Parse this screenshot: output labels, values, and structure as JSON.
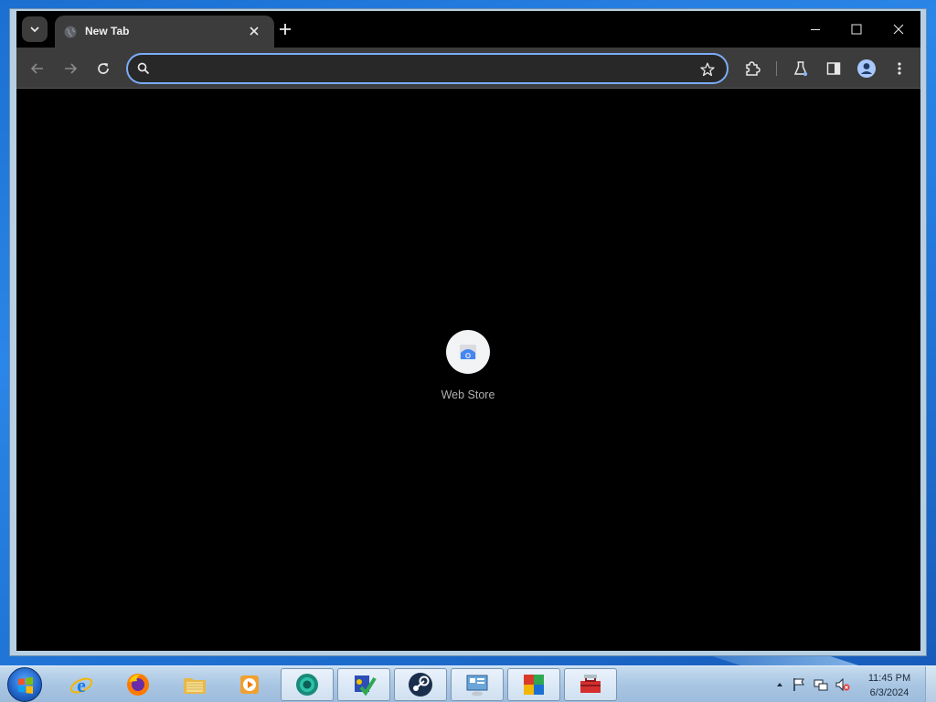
{
  "browser": {
    "tab": {
      "title": "New Tab",
      "favicon": "globe-icon",
      "close_icon": "close-icon"
    },
    "new_tab_icon": "plus-icon",
    "window_controls": [
      "minimize-icon",
      "maximize-icon",
      "close-icon"
    ],
    "toolbar": {
      "back_icon": "arrow-left-icon",
      "forward_icon": "arrow-right-icon",
      "reload_icon": "reload-icon",
      "omnibox": {
        "value": "",
        "placeholder": "",
        "search_icon": "search-icon",
        "bookmark_icon": "star-icon"
      },
      "extensions_icon": "puzzle-icon",
      "labs_icon": "flask-icon",
      "side_panel_icon": "side-panel-icon",
      "profile_icon": "profile-icon",
      "menu_icon": "kebab-menu-icon"
    },
    "ntp": {
      "shortcuts": [
        {
          "label": "Web Store",
          "icon": "web-store-icon"
        }
      ]
    },
    "colors": {
      "frame": "#000000",
      "toolbar": "#3c3c3c",
      "omnibox_focus": "#7cacf8",
      "accent": "#8ab4f8"
    }
  },
  "taskbar": {
    "pinned": [
      {
        "name": "internet-explorer-icon",
        "active": false
      },
      {
        "name": "firefox-icon",
        "active": false
      },
      {
        "name": "file-explorer-icon",
        "active": false
      },
      {
        "name": "media-player-icon",
        "active": false
      },
      {
        "name": "chrome-beta-icon",
        "active": true
      },
      {
        "name": "checklist-app-icon",
        "active": true
      },
      {
        "name": "steam-icon",
        "active": true
      },
      {
        "name": "control-panel-icon",
        "active": true
      },
      {
        "name": "avg-antivirus-icon",
        "active": true
      },
      {
        "name": "toolbox-icon",
        "active": true
      }
    ],
    "tray": [
      "show-hidden-icons-chevron",
      "action-center-flag-icon",
      "network-icon",
      "volume-muted-icon"
    ],
    "clock": {
      "time": "11:45 PM",
      "date": "6/3/2024"
    }
  }
}
